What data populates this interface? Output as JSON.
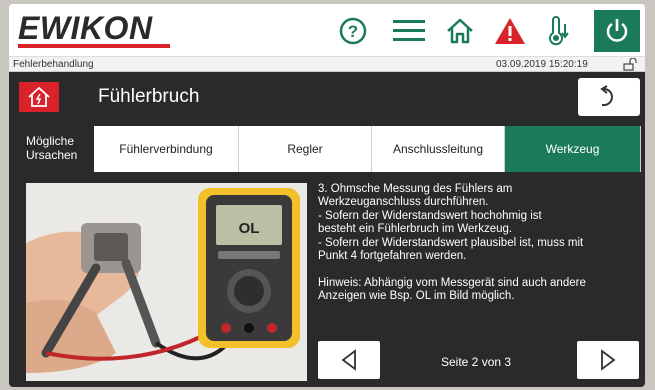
{
  "header": {
    "logo": "EWIKON",
    "icons": [
      "help-icon",
      "menu-icon",
      "home-icon",
      "warning-icon",
      "temperature-icon",
      "power-icon"
    ]
  },
  "status": {
    "section": "Fehlerbehandlung",
    "datetime": "03.09.2019 15:20:19"
  },
  "titlebar": {
    "title": "Fühlerbruch"
  },
  "causes": {
    "label": "Mögliche\nUrsachen",
    "tabs": [
      {
        "label": "Fühlerverbindung",
        "active": false
      },
      {
        "label": "Regler",
        "active": false
      },
      {
        "label": "Anschlussleitung",
        "active": false
      },
      {
        "label": "Werkzeug",
        "active": true
      }
    ]
  },
  "content": {
    "description": "3. Ohmsche Messung des Fühlers am\nWerkzeuganschluss durchführen.\n- Sofern der Widerstandswert hochohmig ist\nbesteht ein Fühlerbruch im Werkzeug.\n- Sofern der Widerstandswert plausibel ist, muss mit\nPunkt 4 fortgefahren werden.\n\nHinweis: Abhängig vom Messgerät sind auch andere\nAnzeigen wie Bsp. OL im Bild möglich.",
    "meter_display": "OL",
    "page_label": "Seite 2 von 3"
  },
  "colors": {
    "accent_green": "#1b7a5c",
    "alarm_red": "#d8232a",
    "dark_bg": "#2a2a2a"
  }
}
